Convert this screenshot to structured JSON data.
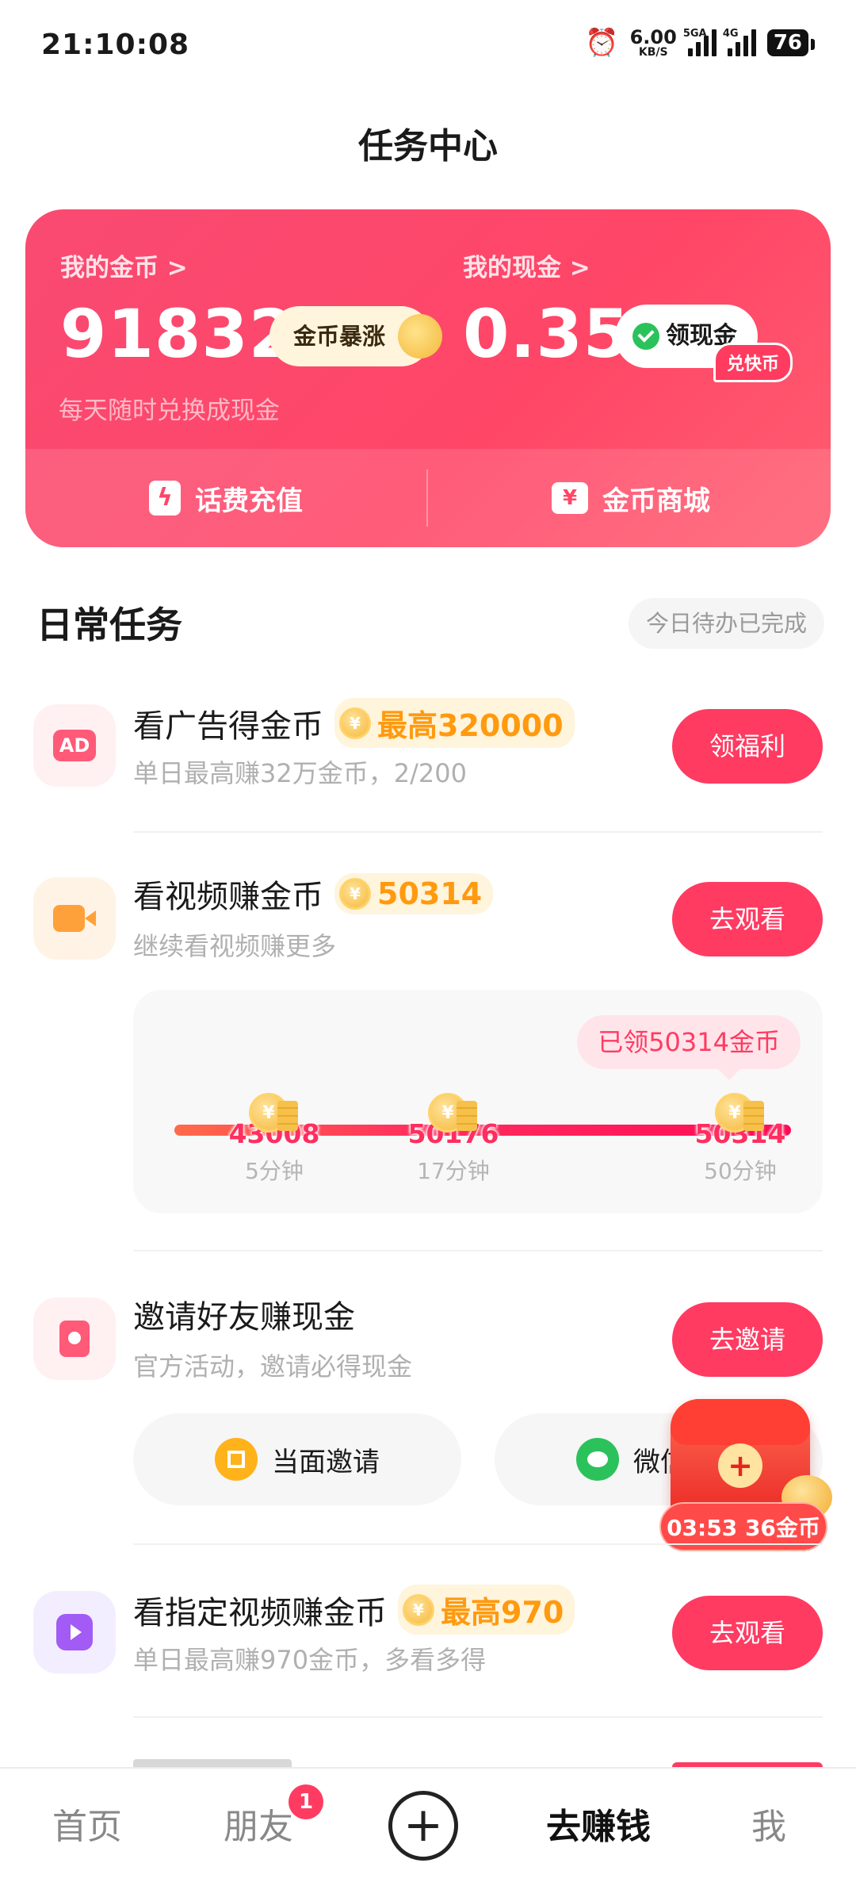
{
  "status_bar": {
    "time": "21:10:08",
    "speed_value": "6.00",
    "speed_unit": "KB/S",
    "net1": "5GA",
    "net2": "4G",
    "battery": "76"
  },
  "page_title": "任务中心",
  "wallet": {
    "coins_label": "我的金币 >",
    "coins_value": "91832",
    "coins_badge": "金币暴涨",
    "cash_label": "我的现金 >",
    "cash_value": "0.35",
    "cash_button": "领现金",
    "subtitle": "每天随时兑换成现金",
    "phone_topup": "话费充值",
    "coin_mall": "金币商城",
    "mall_tag": "兑快币"
  },
  "daily": {
    "title": "日常任务",
    "status": "今日待办已完成"
  },
  "tasks": [
    {
      "name": "看广告得金币",
      "badge": "最高320000",
      "desc": "单日最高赚32万金币，2/200",
      "button": "领福利",
      "icon": "ad-icon"
    },
    {
      "name": "看视频赚金币",
      "badge": "50314",
      "desc": "继续看视频赚更多",
      "button": "去观看",
      "icon": "video-camera-icon"
    },
    {
      "name": "邀请好友赚现金",
      "desc": "官方活动，邀请必得现金",
      "button": "去邀请",
      "icon": "red-envelope-icon"
    },
    {
      "name": "看指定视频赚金币",
      "badge": "最高970",
      "desc": "单日最高赚970金币，多看多得",
      "button": "去观看",
      "icon": "play-icon"
    }
  ],
  "video_progress": {
    "tip": "已领50314金币",
    "milestones": [
      {
        "coins": "43008",
        "time": "5分钟"
      },
      {
        "coins": "50176",
        "time": "17分钟"
      },
      {
        "coins": "50314",
        "time": "50分钟"
      }
    ]
  },
  "invite": {
    "face_to_face": "当面邀请",
    "wechat": "微信邀请"
  },
  "floating": {
    "timer": "03:53 36金币"
  },
  "nav": {
    "home": "首页",
    "friends": "朋友",
    "friends_badge": "1",
    "earn": "去赚钱",
    "me": "我"
  },
  "colors": {
    "primary": "#ff3b62",
    "coin_orange": "#ff9a0f",
    "card_red": "#ff4667"
  }
}
